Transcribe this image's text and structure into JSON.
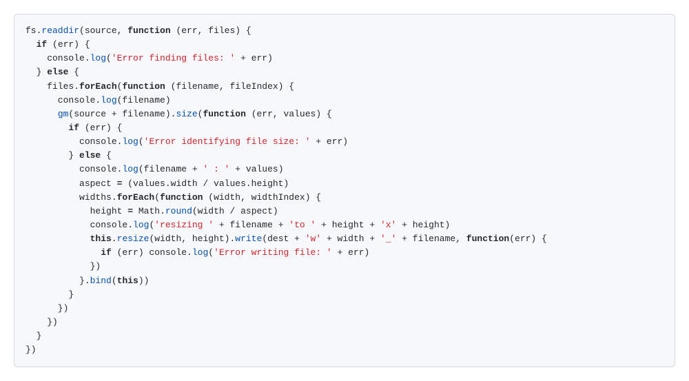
{
  "code": {
    "tokens": [
      [
        {
          "c": "plain",
          "t": "fs."
        },
        {
          "c": "method",
          "t": "readdir"
        },
        {
          "c": "plain",
          "t": "(source, "
        },
        {
          "c": "kw",
          "t": "function"
        },
        {
          "c": "plain",
          "t": " (err, files) {"
        }
      ],
      [
        {
          "c": "plain",
          "t": "  "
        },
        {
          "c": "kw",
          "t": "if"
        },
        {
          "c": "plain",
          "t": " (err) {"
        }
      ],
      [
        {
          "c": "plain",
          "t": "    console."
        },
        {
          "c": "method",
          "t": "log"
        },
        {
          "c": "plain",
          "t": "("
        },
        {
          "c": "str",
          "t": "'Error finding files: '"
        },
        {
          "c": "plain",
          "t": " + err)"
        }
      ],
      [
        {
          "c": "plain",
          "t": "  } "
        },
        {
          "c": "kw",
          "t": "else"
        },
        {
          "c": "plain",
          "t": " {"
        }
      ],
      [
        {
          "c": "plain",
          "t": "    files."
        },
        {
          "c": "kw",
          "t": "forEach"
        },
        {
          "c": "plain",
          "t": "("
        },
        {
          "c": "kw",
          "t": "function"
        },
        {
          "c": "plain",
          "t": " (filename, fileIndex) {"
        }
      ],
      [
        {
          "c": "plain",
          "t": "      console."
        },
        {
          "c": "method",
          "t": "log"
        },
        {
          "c": "plain",
          "t": "(filename)"
        }
      ],
      [
        {
          "c": "plain",
          "t": "      "
        },
        {
          "c": "method",
          "t": "gm"
        },
        {
          "c": "plain",
          "t": "(source + filename)."
        },
        {
          "c": "method",
          "t": "size"
        },
        {
          "c": "plain",
          "t": "("
        },
        {
          "c": "kw",
          "t": "function"
        },
        {
          "c": "plain",
          "t": " (err, values) {"
        }
      ],
      [
        {
          "c": "plain",
          "t": "        "
        },
        {
          "c": "kw",
          "t": "if"
        },
        {
          "c": "plain",
          "t": " (err) {"
        }
      ],
      [
        {
          "c": "plain",
          "t": "          console."
        },
        {
          "c": "method",
          "t": "log"
        },
        {
          "c": "plain",
          "t": "("
        },
        {
          "c": "str",
          "t": "'Error identifying file size: '"
        },
        {
          "c": "plain",
          "t": " + err)"
        }
      ],
      [
        {
          "c": "plain",
          "t": "        } "
        },
        {
          "c": "kw",
          "t": "else"
        },
        {
          "c": "plain",
          "t": " {"
        }
      ],
      [
        {
          "c": "plain",
          "t": "          console."
        },
        {
          "c": "method",
          "t": "log"
        },
        {
          "c": "plain",
          "t": "(filename + "
        },
        {
          "c": "str",
          "t": "' : '"
        },
        {
          "c": "plain",
          "t": " + values)"
        }
      ],
      [
        {
          "c": "plain",
          "t": "          aspect "
        },
        {
          "c": "kw",
          "t": "="
        },
        {
          "c": "plain",
          "t": " (values.width / values.height)"
        }
      ],
      [
        {
          "c": "plain",
          "t": "          widths."
        },
        {
          "c": "kw",
          "t": "forEach"
        },
        {
          "c": "plain",
          "t": "("
        },
        {
          "c": "kw",
          "t": "function"
        },
        {
          "c": "plain",
          "t": " (width, widthIndex) {"
        }
      ],
      [
        {
          "c": "plain",
          "t": "            height "
        },
        {
          "c": "kw",
          "t": "="
        },
        {
          "c": "plain",
          "t": " Math."
        },
        {
          "c": "method",
          "t": "round"
        },
        {
          "c": "plain",
          "t": "(width / aspect)"
        }
      ],
      [
        {
          "c": "plain",
          "t": "            console."
        },
        {
          "c": "method",
          "t": "log"
        },
        {
          "c": "plain",
          "t": "("
        },
        {
          "c": "str",
          "t": "'resizing '"
        },
        {
          "c": "plain",
          "t": " + filename + "
        },
        {
          "c": "str",
          "t": "'to '"
        },
        {
          "c": "plain",
          "t": " + height + "
        },
        {
          "c": "str",
          "t": "'x'"
        },
        {
          "c": "plain",
          "t": " + height)"
        }
      ],
      [
        {
          "c": "plain",
          "t": "            "
        },
        {
          "c": "kw",
          "t": "this"
        },
        {
          "c": "plain",
          "t": "."
        },
        {
          "c": "method",
          "t": "resize"
        },
        {
          "c": "plain",
          "t": "(width, height)."
        },
        {
          "c": "method",
          "t": "write"
        },
        {
          "c": "plain",
          "t": "(dest + "
        },
        {
          "c": "str",
          "t": "'w'"
        },
        {
          "c": "plain",
          "t": " + width + "
        },
        {
          "c": "str",
          "t": "'_'"
        },
        {
          "c": "plain",
          "t": " + filename, "
        },
        {
          "c": "kw",
          "t": "function"
        },
        {
          "c": "plain",
          "t": "(err) {"
        }
      ],
      [
        {
          "c": "plain",
          "t": "              "
        },
        {
          "c": "kw",
          "t": "if"
        },
        {
          "c": "plain",
          "t": " (err) console."
        },
        {
          "c": "method",
          "t": "log"
        },
        {
          "c": "plain",
          "t": "("
        },
        {
          "c": "str",
          "t": "'Error writing file: '"
        },
        {
          "c": "plain",
          "t": " + err)"
        }
      ],
      [
        {
          "c": "plain",
          "t": "            })"
        }
      ],
      [
        {
          "c": "plain",
          "t": "          }."
        },
        {
          "c": "method",
          "t": "bind"
        },
        {
          "c": "plain",
          "t": "("
        },
        {
          "c": "kw",
          "t": "this"
        },
        {
          "c": "plain",
          "t": "))"
        }
      ],
      [
        {
          "c": "plain",
          "t": "        }"
        }
      ],
      [
        {
          "c": "plain",
          "t": "      })"
        }
      ],
      [
        {
          "c": "plain",
          "t": "    })"
        }
      ],
      [
        {
          "c": "plain",
          "t": "  }"
        }
      ],
      [
        {
          "c": "plain",
          "t": "})"
        }
      ]
    ]
  }
}
